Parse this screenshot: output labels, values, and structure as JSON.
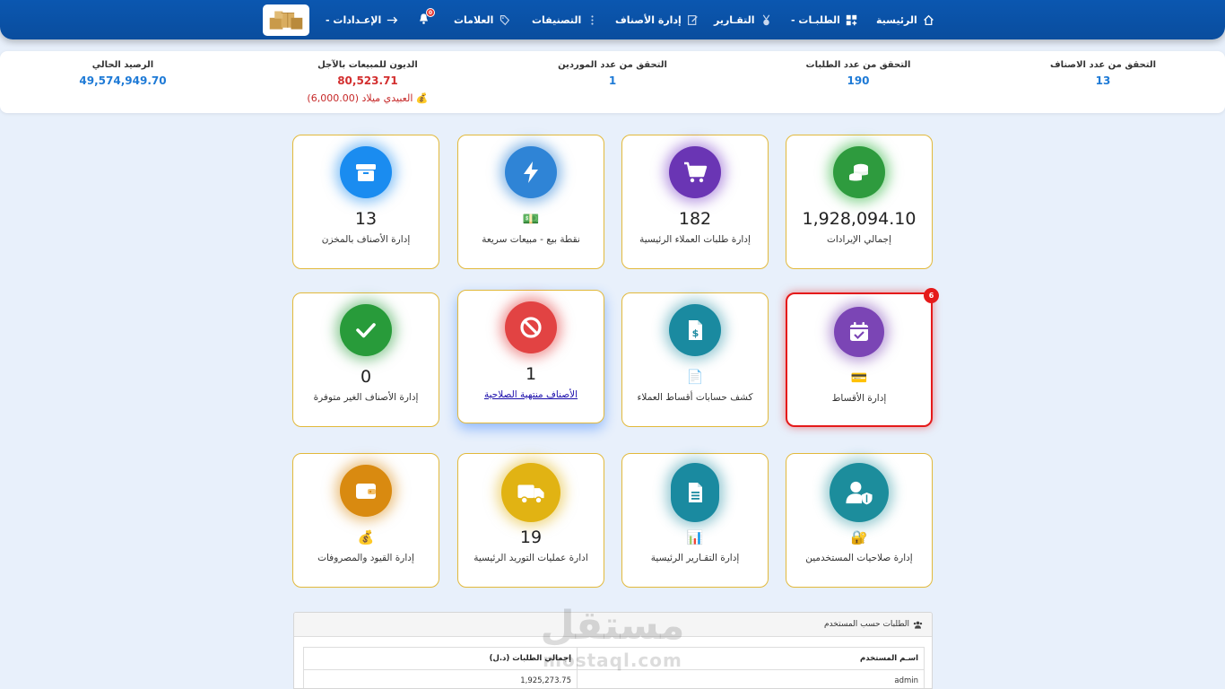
{
  "nav": {
    "home": "الرئيسية",
    "orders": "الطلبـات -",
    "reports": "التقـارير",
    "items": "إدارة الأصناف",
    "categories": "التصنيفات",
    "brands": "العلامات",
    "settings": "الإعـدادات -",
    "bell_count": "0"
  },
  "stats": {
    "items_label": "التحقق من عدد الاصناف",
    "items_value": "13",
    "orders_label": "التحقق من عدد الطلبات",
    "orders_value": "190",
    "suppliers_label": "التحقق من عدد الموردين",
    "suppliers_value": "1",
    "debts_label": "الديون للمبيعات بالآجل",
    "debts_value": "80,523.71",
    "debts_top": "💰 العبيدي ميلاد (6,000.00)",
    "balance_label": "الرصيد الحالي",
    "balance_value": "49,574,949.70"
  },
  "cards": {
    "revenue": {
      "count": "1,928,094.10",
      "label": "إجمالي الإيرادات"
    },
    "customer_orders": {
      "count": "182",
      "label": "إدارة طلبات العملاء الرئيسية"
    },
    "pos": {
      "emoji": "💵",
      "label": "نقطة بيع - مبيعات سريعة"
    },
    "stock": {
      "count": "13",
      "label": "إدارة الأصناف بالمخزن"
    },
    "installments": {
      "emoji": "💳",
      "label": "إدارة الأقساط",
      "badge": "6"
    },
    "installment_statement": {
      "emoji": "📄",
      "label": "كشف حسابات أقساط العملاء"
    },
    "expired": {
      "count": "1",
      "label": "الأصناف منتهية الصلاحية"
    },
    "unavailable": {
      "count": "0",
      "label": "إدارة الأصناف الغير متوفرة"
    },
    "permissions": {
      "emoji": "🔐",
      "label": "إدارة صلاحيات المستخدمين"
    },
    "main_reports": {
      "emoji": "📊",
      "label": "إدارة التقـارير الرئيسية"
    },
    "supply": {
      "count": "19",
      "label": "ادارة عمليات التوريد الرئيسية"
    },
    "expenses": {
      "emoji": "💰",
      "label": "إدارة القيود والمصروفات"
    }
  },
  "panel": {
    "title": "الطلبات حسب المستخدم",
    "col_user": "اسـم المستخدم",
    "col_total": "إجمالي الطلبات (د.ل)",
    "rows": [
      {
        "user": "admin",
        "total": "1,925,273.75"
      }
    ]
  },
  "watermark": {
    "ar": "مستقل",
    "en": "mostaql.com"
  },
  "colors": {
    "nav": "#0b57b0",
    "accent": "#1e7ad6",
    "card_border": "#e2b93b",
    "alert": "#e51a1a"
  }
}
